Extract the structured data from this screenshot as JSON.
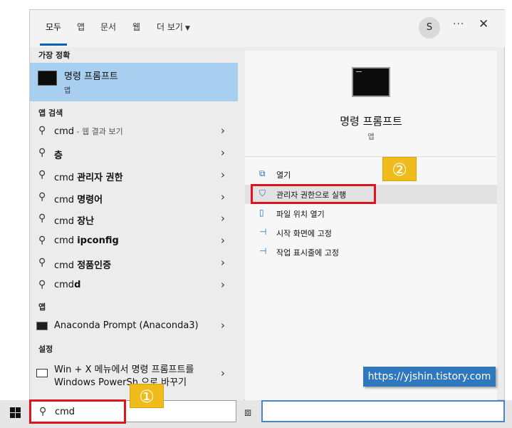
{
  "tabs": [
    {
      "label": "모두"
    },
    {
      "label": "앱"
    },
    {
      "label": "문서"
    },
    {
      "label": "웹"
    },
    {
      "label": "더 보기"
    }
  ],
  "topbar": {
    "avatar_letter": "S",
    "more_glyph": "···",
    "close_glyph": "✕"
  },
  "sections": {
    "best_match": "가장 정확",
    "app_search": "앱 검색",
    "apps": "앱",
    "settings": "설정"
  },
  "best_match": {
    "title": "명령 프롬프트",
    "subtitle": "앱"
  },
  "search_rows": [
    {
      "prefix": "cmd",
      "suffix": " - 웹 결과 보기"
    },
    {
      "prefix": "",
      "bold": "층"
    },
    {
      "prefix": "cmd ",
      "bold": "관리자 권한"
    },
    {
      "prefix": "cmd ",
      "bold": "명령어"
    },
    {
      "prefix": "cmd ",
      "bold": "장난"
    },
    {
      "prefix": "cmd ",
      "bold": "ipconfig"
    },
    {
      "prefix": "cmd ",
      "bold": "정품인증"
    },
    {
      "prefix": "cmd",
      "bold": "d"
    }
  ],
  "apps": [
    {
      "label": "Anaconda Prompt (Anaconda3)"
    }
  ],
  "settings_item": {
    "line1": "Win + X 메뉴에서 명령 프롬프트를",
    "line2": "Windows PowerSh    으로 바꾸기"
  },
  "detail": {
    "title": "명령 프롬프트",
    "subtitle": "앱"
  },
  "actions": [
    {
      "label": "열기",
      "icon": "open-icon"
    },
    {
      "label": "관리자 권한으로 실행",
      "icon": "shield-icon"
    },
    {
      "label": "파일 위치 열기",
      "icon": "folder-icon"
    },
    {
      "label": "시작 화면에 고정",
      "icon": "pin-icon"
    },
    {
      "label": "작업 표시줄에 고정",
      "icon": "pin-icon"
    }
  ],
  "taskbar": {
    "search_value": "cmd"
  },
  "annotations": {
    "badge1": "①",
    "badge2": "②",
    "url": "https://yjshin.tistory.com"
  },
  "colors": {
    "accent": "#0a5fb6",
    "highlight": "#a9cff0",
    "annotation_red": "#e0141e",
    "badge_yellow": "#f0bc1c",
    "url_blue": "#2f78bd"
  }
}
